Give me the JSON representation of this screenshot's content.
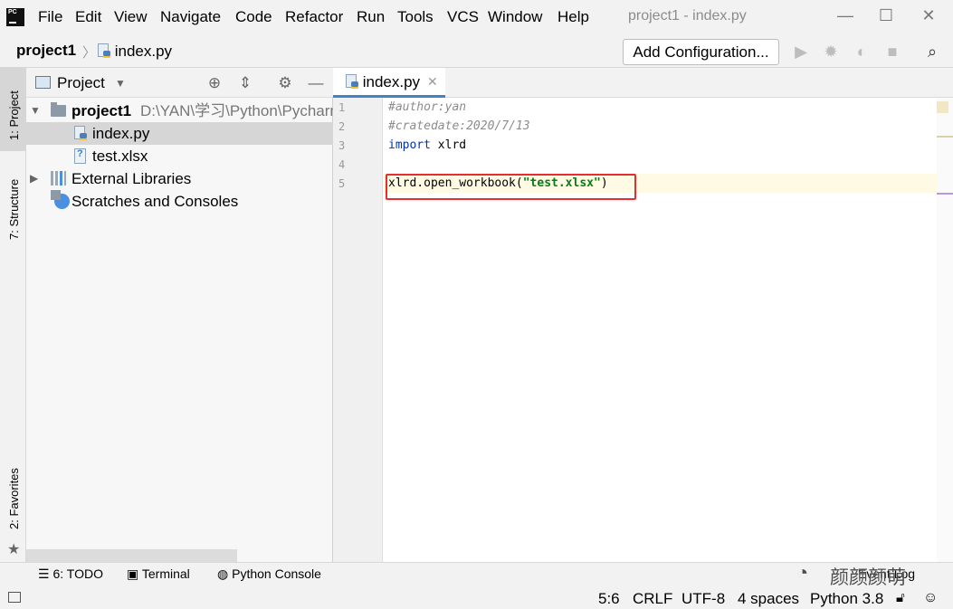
{
  "menu": [
    "File",
    "Edit",
    "View",
    "Navigate",
    "Code",
    "Refactor",
    "Run",
    "Tools",
    "VCS",
    "Window",
    "Help"
  ],
  "window_title": "project1 - index.py",
  "breadcrumb": {
    "project": "project1",
    "file": "index.py"
  },
  "toolbar": {
    "add_configuration": "Add Configuration..."
  },
  "left_stripe": {
    "project": "1: Project",
    "structure": "7: Structure",
    "favorites": "2: Favorites"
  },
  "project_pane": {
    "title": "Project",
    "items": [
      {
        "label": "project1",
        "path": "D:\\YAN\\学习\\Python\\Pycharm"
      },
      {
        "label": "index.py"
      },
      {
        "label": "test.xlsx"
      },
      {
        "label": "External Libraries"
      },
      {
        "label": "Scratches and Consoles"
      }
    ]
  },
  "editor": {
    "tab": "index.py",
    "line_numbers": [
      "1",
      "2",
      "3",
      "4",
      "5"
    ],
    "lines": [
      "#author:yan",
      "#cratedate:2020/7/13",
      "import xlrd",
      "",
      "xlrd.open_workbook(\"test.xlsx\")"
    ]
  },
  "bottom_tools": {
    "todo": "6: TODO",
    "terminal": "Terminal",
    "python_console": "Python Console"
  },
  "status": {
    "position": "5:6",
    "line_sep": "CRLF",
    "encoding": "UTF-8",
    "indent": "4 spaces",
    "interpreter": "Python 3.8"
  },
  "watermark": "颜颜颜萌",
  "event_log": "Event Log",
  "colors": {
    "selection": "#d6d6d6",
    "keyword": "#0033b3",
    "string": "#067d17",
    "highlight_box": "#e72d2d",
    "current_line": "#fffae3"
  }
}
